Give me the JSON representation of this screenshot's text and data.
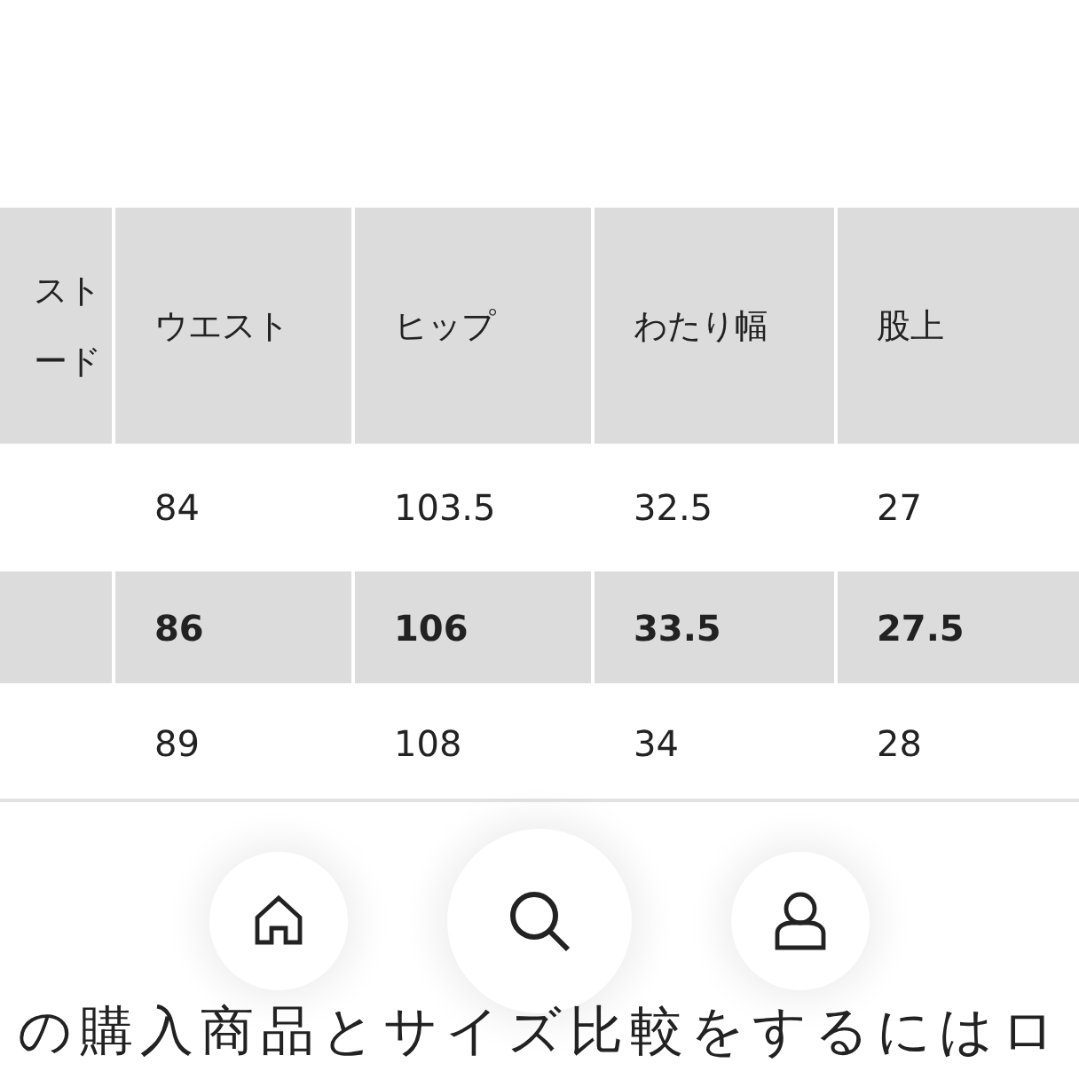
{
  "size_table": {
    "columns": [
      {
        "lines": [
          "スト",
          "ード"
        ]
      },
      {
        "lines": [
          "ウエスト"
        ]
      },
      {
        "lines": [
          "ヒップ"
        ]
      },
      {
        "lines": [
          "わたり幅"
        ]
      },
      {
        "lines": [
          "股上"
        ]
      }
    ],
    "rows": [
      {
        "highlighted": false,
        "cells": [
          "",
          "84",
          "103.5",
          "32.5",
          "27"
        ]
      },
      {
        "highlighted": true,
        "cells": [
          "",
          "86",
          "106",
          "33.5",
          "27.5"
        ]
      },
      {
        "highlighted": false,
        "cells": [
          "",
          "89",
          "108",
          "34",
          "28"
        ]
      }
    ]
  },
  "nav": {
    "items": [
      {
        "kind": "home"
      },
      {
        "kind": "search"
      },
      {
        "kind": "account"
      }
    ]
  },
  "login_prompt": "の購入商品とサイズ比較をするにはロ"
}
